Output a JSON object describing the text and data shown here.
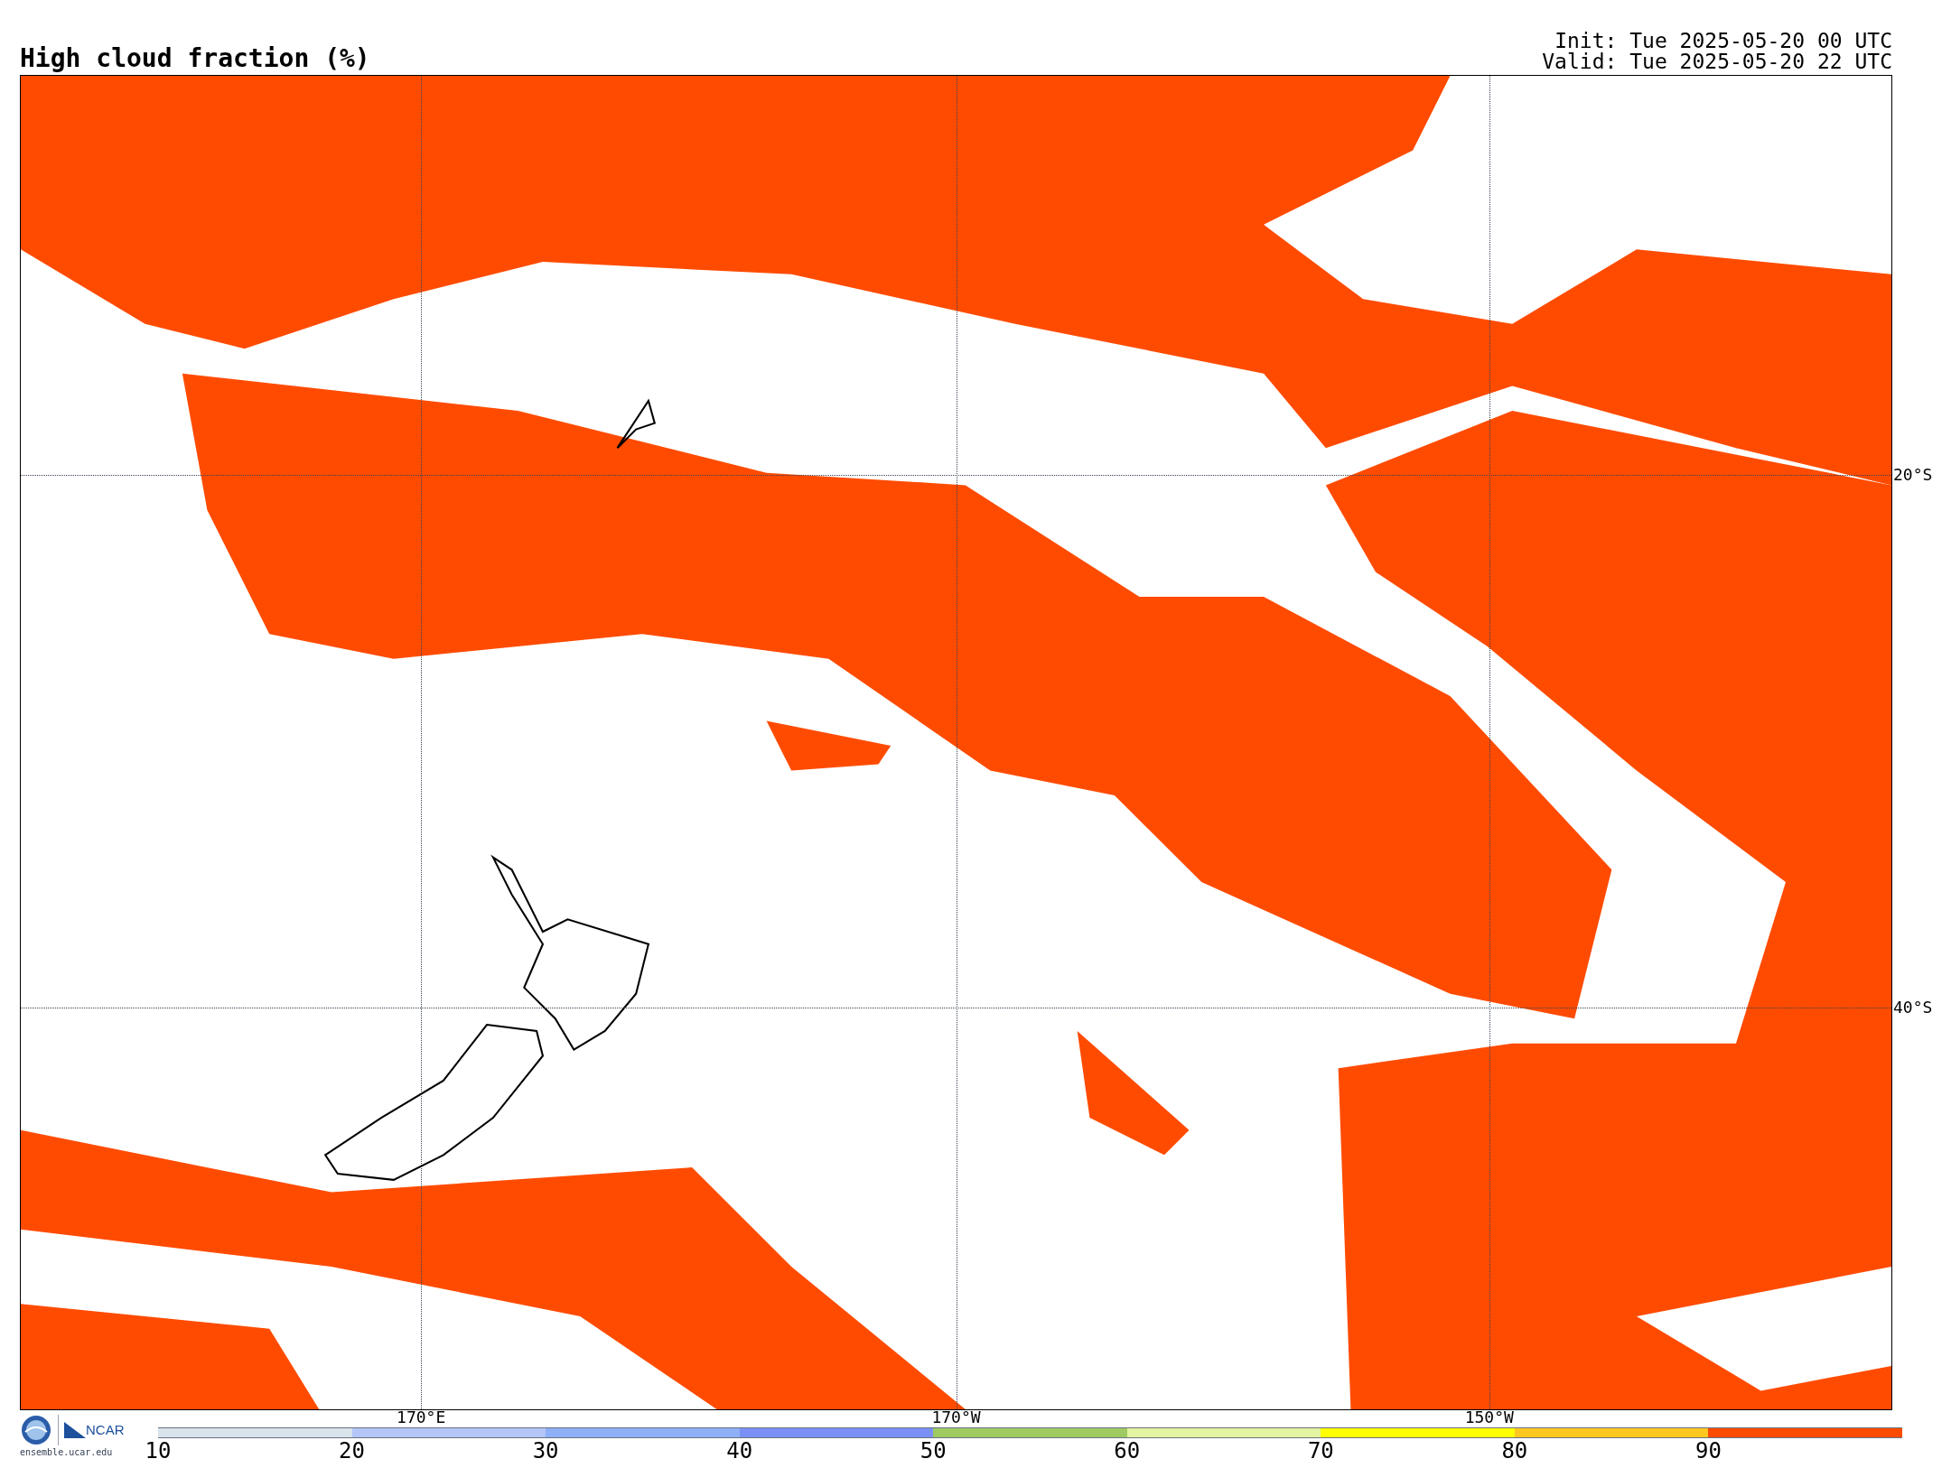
{
  "title": "High cloud fraction (%)",
  "init": "Init: Tue 2025-05-20 00 UTC",
  "valid": "Valid: Tue 2025-05-20 22 UTC",
  "map": {
    "latitude_labels": [
      "20°S",
      "40°S"
    ],
    "longitude_labels": [
      "170°E",
      "170°W",
      "150°W"
    ]
  },
  "logo": {
    "name": "NCAR",
    "site": "ensemble.ucar.edu"
  },
  "colorbar": [
    {
      "label": "10",
      "color": "#d9e3ec"
    },
    {
      "label": "20",
      "color": "#b3c6f7"
    },
    {
      "label": "30",
      "color": "#8fb0f7"
    },
    {
      "label": "40",
      "color": "#7a90f5"
    },
    {
      "label": "50",
      "color": "#9fca62"
    },
    {
      "label": "60",
      "color": "#e4f5a2"
    },
    {
      "label": "70",
      "color": "#ffff00"
    },
    {
      "label": "80",
      "color": "#ffc820"
    },
    {
      "label": "90",
      "color": "#ff4b00"
    }
  ]
}
